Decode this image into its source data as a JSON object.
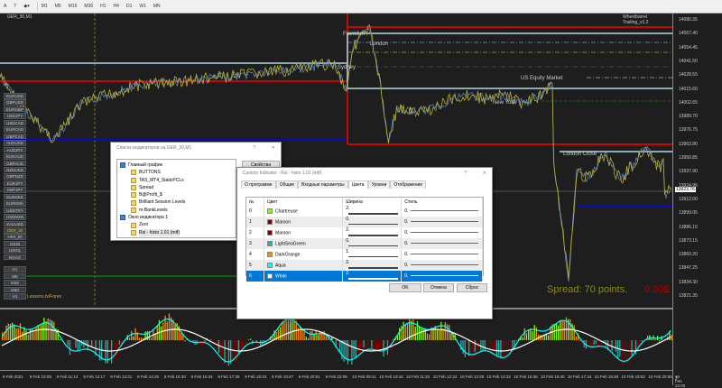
{
  "toolbar": {
    "timeframes": [
      "M1",
      "M5",
      "M15",
      "M30",
      "H1",
      "H4",
      "D1",
      "W1",
      "MN"
    ]
  },
  "chart": {
    "symbol_title": "GER_30,M1",
    "ea_label": "Wheelbarrel Trailing_v1.2",
    "watermark": "Lessons.tv/Forex",
    "session_labels": {
      "frankfurt": "Frankfurt",
      "london": "London",
      "sydney": "Sydney",
      "new_york": "New York",
      "us_equity": "US Equity Market",
      "london_close": "London Close"
    },
    "spread": "Spread: 70 points.",
    "profit": "0.00$",
    "colors": {
      "red": "#ff0000",
      "lightblue": "#add8e6",
      "blue": "#0000ff",
      "green": "#008000",
      "price": "#b8b030",
      "price2": "#5b8fd8"
    }
  },
  "symbols": [
    "EURUSD",
    "GBPUSD",
    "EURGBP",
    "USDJPY",
    "USDCAD",
    "EURCAD",
    "GBPCAD",
    "AUDUSD",
    "AUDJPY",
    "EURAUD",
    "GBPAUD",
    "NZDUSD",
    "GBPNZD",
    "EURJPY",
    "GBPJPY",
    "EURSEK",
    "EURNOK",
    "USDTRY",
    "USDMXN",
    "XAUUSD",
    "GER_30",
    "HK0_50",
    "US30",
    "USOIL",
    "NGAS"
  ],
  "active_symbol": "GER_30",
  "period_buttons": [
    "M1",
    "M5",
    "M15",
    "M30",
    "H1"
  ],
  "price_axis": [
    "14080.35",
    "14067.40",
    "14054.45",
    "14041.50",
    "14028.55",
    "14015.60",
    "14002.65",
    "13989.70",
    "13976.75",
    "13963.80",
    "13950.85",
    "13937.90",
    "13924.95",
    "13912.00",
    "13899.05",
    "13886.10",
    "13873.15",
    "13860.20",
    "13847.25",
    "13834.30",
    "13821.35"
  ],
  "current_price": "13923.76",
  "subwindow_label": "2",
  "time_axis": [
    "9 Feb 2021",
    "9 Feb 10:09",
    "9 Feb 11:13",
    "9 Feb 12:17",
    "9 Feb 13:21",
    "9 Feb 14:25",
    "9 Feb 15:30",
    "9 Feb 16:34",
    "9 Feb 17:39",
    "9 Feb 18:43",
    "9 Feb 19:47",
    "9 Feb 20:51",
    "9 Feb 22:08",
    "10 Feb 09:11",
    "10 Feb 10:16",
    "10 Feb 11:20",
    "10 Feb 12:24",
    "10 Feb 13:28",
    "10 Feb 14:32",
    "10 Feb 15:36",
    "10 Feb 16:40",
    "10 Feb 17:44",
    "10 Feb 18:48",
    "10 Feb 19:52",
    "10 Feb 20:56",
    "10 Feb 22:00"
  ],
  "indicator_list": {
    "title": "Список индикаторов на GER_30,M1",
    "help": "?",
    "close": "✕",
    "properties_button": "Свойства",
    "main_chart": "Главный график",
    "main_items": [
      "BUTTONS",
      "TAS_MT4_StaticPCLs",
      "Spread",
      "B@Profit_$",
      "Brilliant Session Levels",
      "m-BankLevels"
    ],
    "sub_window": "Окно индикатора 1",
    "sub_items": [
      "Zero",
      "Rsi - histo 1.01 (mtf)"
    ]
  },
  "custom_indicator": {
    "title": "Custom Indicator - Rsi - histo 1.01 (mtf)",
    "help": "?",
    "close": "✕",
    "tabs": [
      "О программе",
      "Общие",
      "Входные параметры",
      "Цвета",
      "Уровни",
      "Отображение"
    ],
    "active_tab": "Цвета",
    "columns": [
      "№",
      "Цвет",
      "Ширина",
      "Стиль"
    ],
    "rows": [
      {
        "n": "0",
        "color_name": "Chartreuse",
        "hex": "#7fff00",
        "width": "2.",
        "style": "0."
      },
      {
        "n": "1",
        "color_name": "Maroon",
        "hex": "#800000",
        "width": "0.",
        "style": "0."
      },
      {
        "n": "2",
        "color_name": "Maroon",
        "hex": "#800000",
        "width": "2.",
        "style": "0."
      },
      {
        "n": "3",
        "color_name": "LightSeaGreen",
        "hex": "#20b2aa",
        "width": "0.",
        "style": "0."
      },
      {
        "n": "4",
        "color_name": "DarkOrange",
        "hex": "#ff8c00",
        "width": "1.",
        "style": "0."
      },
      {
        "n": "5",
        "color_name": "Aqua",
        "hex": "#00ffff",
        "width": "2.",
        "style": "0."
      },
      {
        "n": "6",
        "color_name": "White",
        "hex": "#ffffff",
        "width": "2.",
        "style": "0."
      }
    ],
    "selected_row": 6,
    "ok": "OK",
    "cancel": "Отмена",
    "reset": "Сброс"
  }
}
